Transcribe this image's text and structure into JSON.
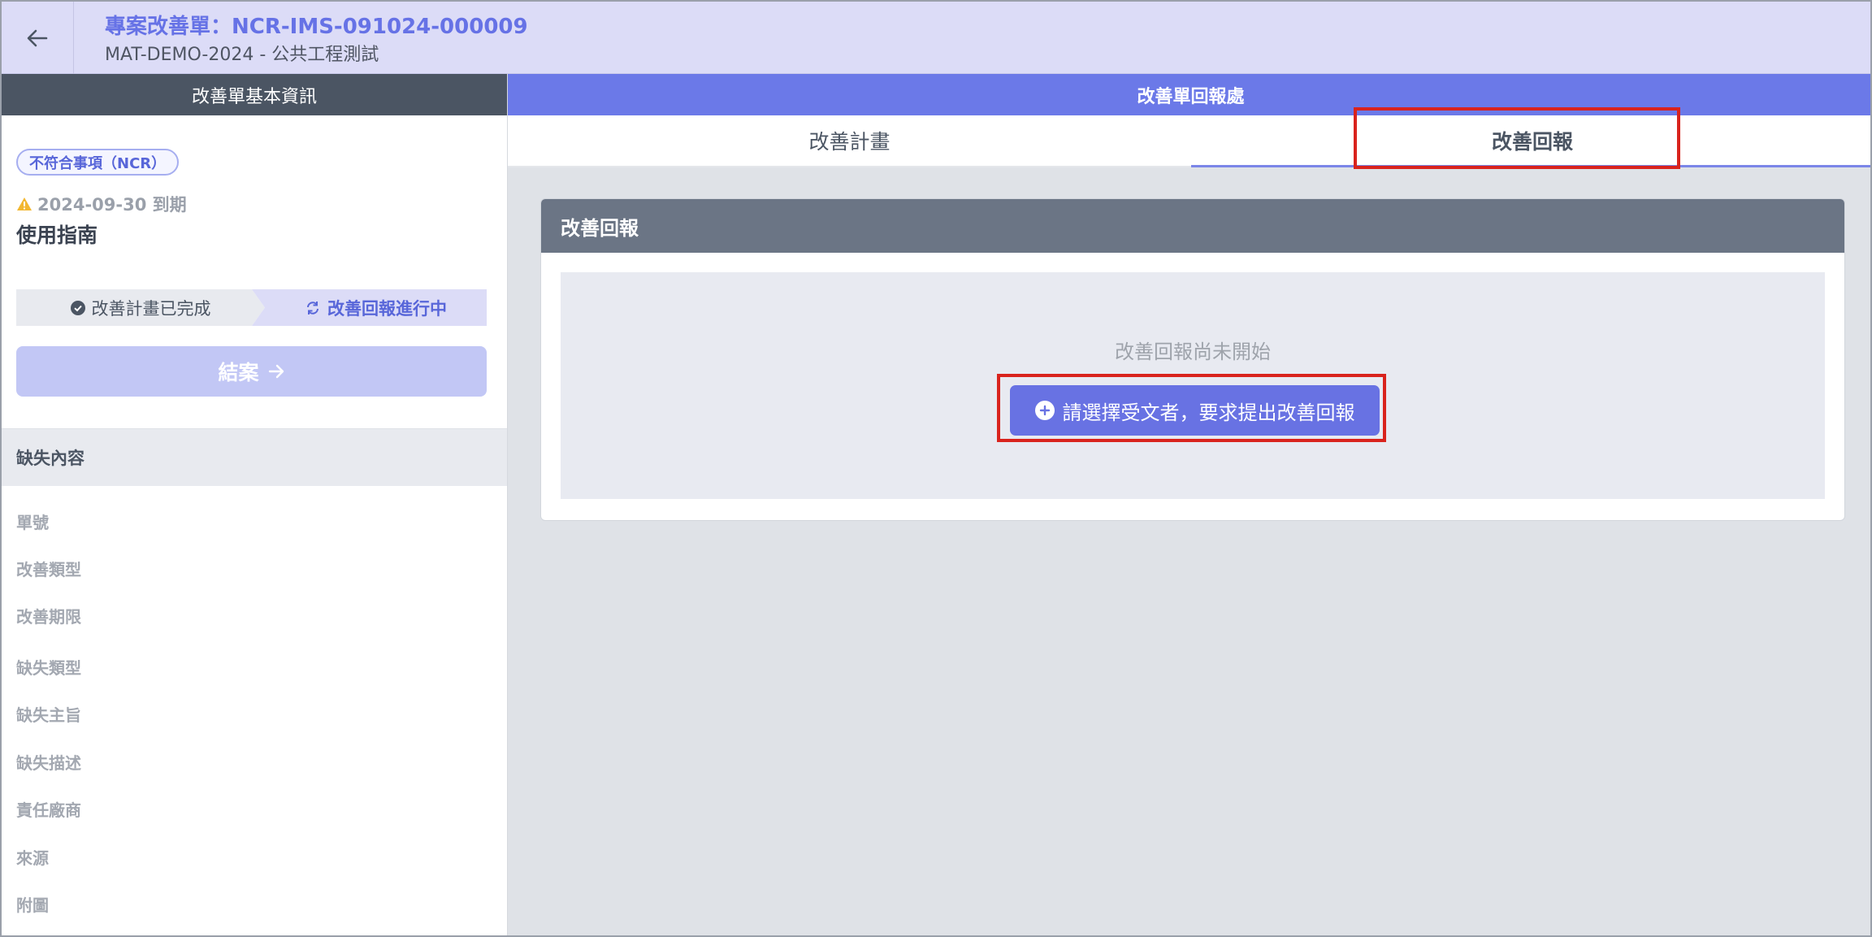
{
  "header": {
    "title": "專案改善單：NCR-IMS-091024-000009",
    "subtitle": "MAT-DEMO-2024 - 公共工程測試",
    "back_icon": "arrow-left-icon"
  },
  "left_panel": {
    "heading": "改善單基本資訊",
    "badge": "不符合事項（NCR）",
    "due_date": "2024-09-30 到期",
    "guide_title": "使用指南",
    "steps": [
      {
        "label": "改善計畫已完成",
        "icon": "check-circle-icon",
        "state": "done"
      },
      {
        "label": "改善回報進行中",
        "icon": "refresh-icon",
        "state": "active"
      }
    ],
    "close_button": "結案",
    "section_title": "缺失內容",
    "fields": [
      "單號",
      "改善類型",
      "改善期限",
      "缺失類型",
      "缺失主旨",
      "缺失描述",
      "責任廠商",
      "來源",
      "附圖"
    ]
  },
  "right_panel": {
    "heading": "改善單回報處",
    "tabs": [
      {
        "label": "改善計畫",
        "active": false
      },
      {
        "label": "改善回報",
        "active": true
      }
    ],
    "card": {
      "title": "改善回報",
      "empty_text": "改善回報尚未開始",
      "request_button": "請選擇受文者，要求提出改善回報"
    }
  },
  "colors": {
    "header_bg": "#dcdcf7",
    "accent": "#6872e3",
    "left_head_bg": "#4b5563",
    "highlight": "#d9231d"
  }
}
